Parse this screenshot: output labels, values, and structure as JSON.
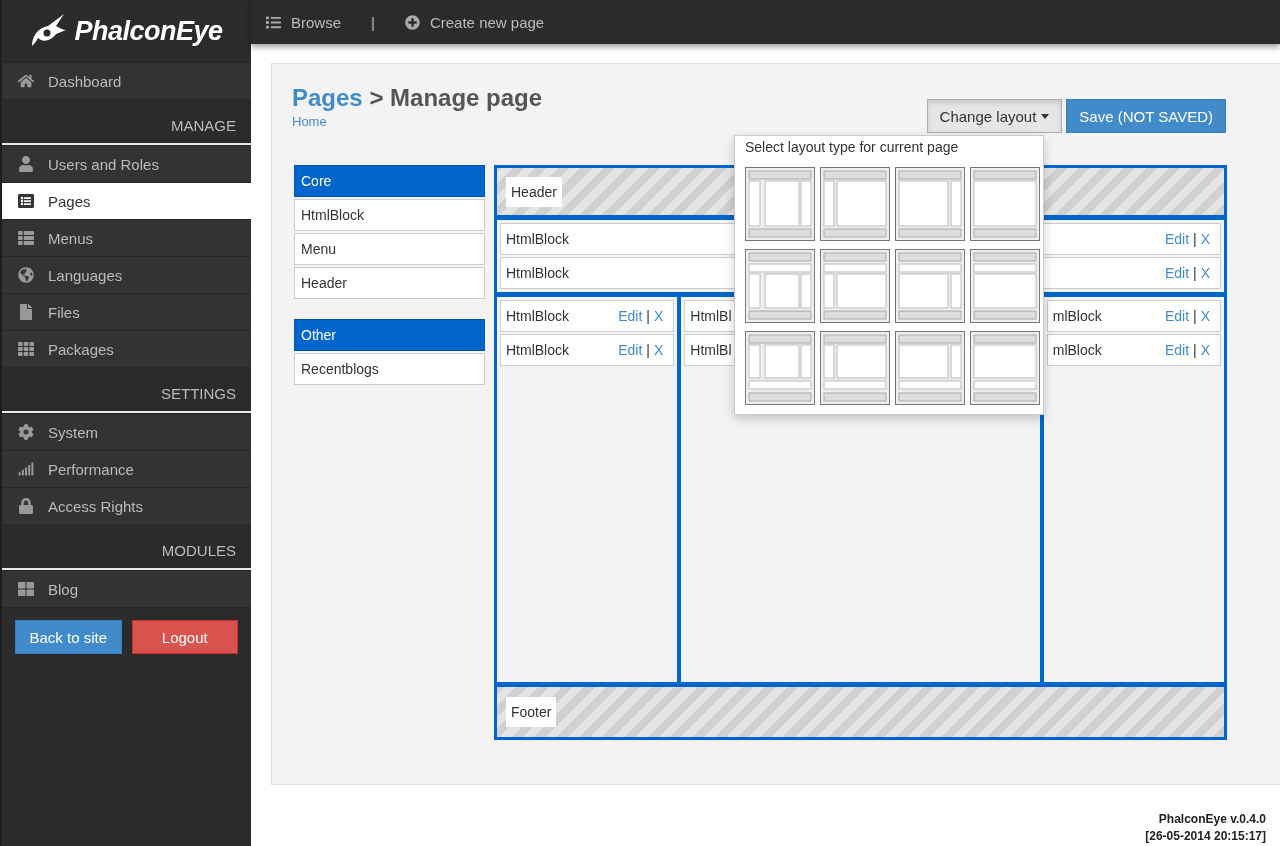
{
  "logo": {
    "text": "PhalconEye"
  },
  "sidebar": {
    "sections": [
      {
        "items": [
          {
            "label": "Dashboard",
            "selected": false
          }
        ]
      },
      {
        "title": "MANAGE",
        "items": [
          {
            "label": "Users and Roles",
            "selected": false
          },
          {
            "label": "Pages",
            "selected": true
          },
          {
            "label": "Menus",
            "selected": false
          },
          {
            "label": "Languages",
            "selected": false
          },
          {
            "label": "Files",
            "selected": false
          },
          {
            "label": "Packages",
            "selected": false
          }
        ]
      },
      {
        "title": "SETTINGS",
        "items": [
          {
            "label": "System",
            "selected": false
          },
          {
            "label": "Performance",
            "selected": false
          },
          {
            "label": "Access Rights",
            "selected": false
          }
        ]
      },
      {
        "title": "MODULES",
        "items": [
          {
            "label": "Blog",
            "selected": false
          }
        ]
      }
    ],
    "buttons": [
      {
        "label": "Back to site",
        "kind": "primary"
      },
      {
        "label": "Logout",
        "kind": "danger"
      }
    ]
  },
  "topbar": {
    "links": [
      {
        "label": "Browse",
        "kind": "list"
      },
      {
        "label": "|",
        "kind": "separator"
      },
      {
        "label": "Create new page",
        "kind": "create"
      }
    ]
  },
  "title": {
    "link": "Pages",
    "rest": "> Manage page",
    "breadcrumb": "Home"
  },
  "actions": {
    "change_layout": "Change layout",
    "save": "Save (NOT SAVED)"
  },
  "layout_menu": {
    "title": "Select layout type for current page",
    "options": [
      {
        "kind": "lmr"
      },
      {
        "kind": "lm"
      },
      {
        "kind": "mr"
      },
      {
        "kind": "m"
      },
      {
        "kind": "lmr_top"
      },
      {
        "kind": "lm_top"
      },
      {
        "kind": "mr_top"
      },
      {
        "kind": "m_top"
      },
      {
        "kind": "lmr_bottom"
      },
      {
        "kind": "lm_bottom"
      },
      {
        "kind": "mr_bottom"
      },
      {
        "kind": "m_bottom"
      }
    ]
  },
  "palette": [
    {
      "title": "Core",
      "items": [
        "HtmlBlock",
        "Menu",
        "Header"
      ]
    },
    {
      "title": "Other",
      "items": [
        "Recentblogs"
      ]
    }
  ],
  "layout": {
    "header": "Header",
    "footer": "Footer",
    "top": [
      {
        "name": "HtmlBlock",
        "edit": "Edit",
        "separator": "|",
        "remove": "X"
      },
      {
        "name": "HtmlBlock",
        "edit": "Edit",
        "separator": "|",
        "remove": "X"
      }
    ],
    "columns": [
      {
        "blocks": [
          {
            "name": "HtmlBlock",
            "edit": "Edit",
            "separator": "|",
            "remove": "X"
          },
          {
            "name": "HtmlBlock",
            "edit": "Edit",
            "separator": "|",
            "remove": "X"
          }
        ]
      },
      {
        "blocks": [
          {
            "name": "HtmlBl"
          },
          {
            "name": "HtmlBl"
          }
        ]
      },
      {
        "blocks": [
          {
            "name": "mlBlock",
            "edit": "Edit",
            "separator": "|",
            "remove": "X"
          },
          {
            "name": "mlBlock",
            "edit": "Edit",
            "separator": "|",
            "remove": "X"
          }
        ]
      }
    ]
  },
  "footer": {
    "version": "PhalconEye v.0.4.0",
    "date": "[26-05-2014 20:15:17]"
  }
}
